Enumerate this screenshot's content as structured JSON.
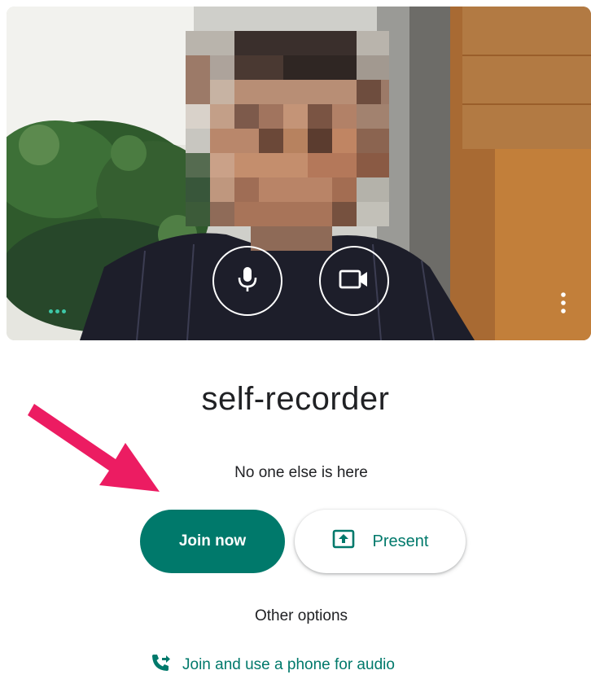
{
  "meeting": {
    "name": "self-recorder",
    "status": "No one else is here"
  },
  "actions": {
    "join_label": "Join now",
    "present_label": "Present",
    "other_options_label": "Other options",
    "phone_audio_label": "Join and use a phone for audio"
  },
  "preview": {
    "mic_icon": "microphone-icon",
    "camera_icon": "video-camera-icon",
    "more_icon": "more-vert-icon"
  },
  "colors": {
    "accent": "#00796b",
    "annotation_arrow": "#ec1c62"
  }
}
